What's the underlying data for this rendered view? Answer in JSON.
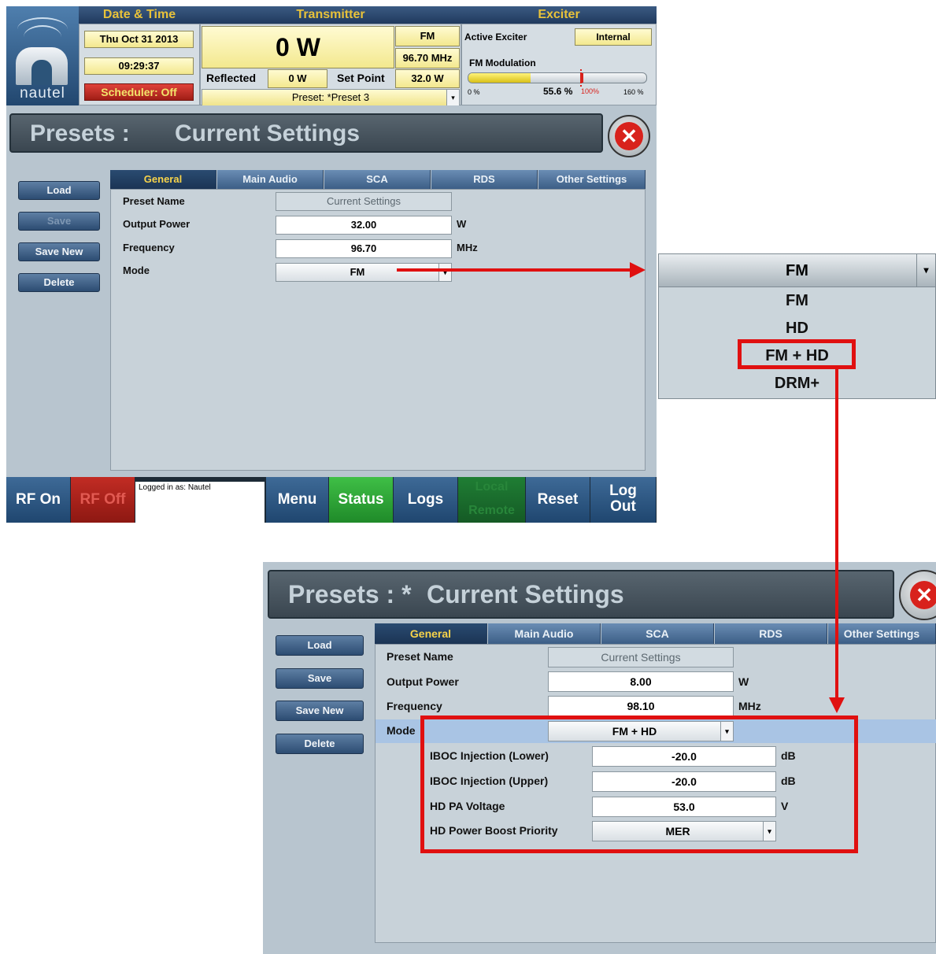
{
  "header": {
    "date_time_label": "Date & Time",
    "transmitter_label": "Transmitter",
    "exciter_label": "Exciter",
    "date": "Thu Oct 31 2013",
    "time": "09:29:37",
    "scheduler": "Scheduler: Off",
    "brand": "nautel",
    "power": "0 W",
    "mode": "FM",
    "frequency": "96.70 MHz",
    "reflected_label": "Reflected",
    "reflected_value": "0 W",
    "set_point_label": "Set Point",
    "set_point_value": "32.0 W",
    "preset": "Preset: *Preset 3",
    "active_exciter_label": "Active Exciter",
    "active_exciter_value": "Internal",
    "fm_modulation_label": "FM Modulation",
    "mod_min": "0 %",
    "mod_value": "55.6 %",
    "mod_100": "100%",
    "mod_max": "160 %",
    "mod_fraction": 0.556
  },
  "screen1": {
    "title_prefix": "Presets :",
    "title_name": "Current Settings",
    "side_buttons": {
      "load": "Load",
      "save": "Save",
      "save_new": "Save New",
      "delete": "Delete"
    },
    "tabs": [
      "General",
      "Main Audio",
      "SCA",
      "RDS",
      "Other Settings"
    ],
    "fields": {
      "preset_name_label": "Preset Name",
      "preset_name_value": "Current Settings",
      "output_power_label": "Output Power",
      "output_power_value": "32.00",
      "output_power_unit": "W",
      "frequency_label": "Frequency",
      "frequency_value": "96.70",
      "frequency_unit": "MHz",
      "mode_label": "Mode",
      "mode_value": "FM"
    }
  },
  "nav": {
    "rf_on": "RF On",
    "rf_off": "RF Off",
    "logged_in": "Logged in as: Nautel",
    "menu": "Menu",
    "status": "Status",
    "logs": "Logs",
    "local": "Local",
    "remote": "Remote",
    "reset": "Reset",
    "log_out_1": "Log",
    "log_out_2": "Out"
  },
  "mode_dropdown": {
    "selected": "FM",
    "options": [
      "FM",
      "HD",
      "FM + HD",
      "DRM+"
    ],
    "highlighted": "FM + HD"
  },
  "screen2": {
    "title_prefix": "Presets : *",
    "title_name": "Current Settings",
    "side_buttons": {
      "load": "Load",
      "save": "Save",
      "save_new": "Save New",
      "delete": "Delete"
    },
    "tabs": [
      "General",
      "Main Audio",
      "SCA",
      "RDS",
      "Other Settings"
    ],
    "fields": {
      "preset_name_label": "Preset Name",
      "preset_name_value": "Current Settings",
      "output_power_label": "Output Power",
      "output_power_value": "8.00",
      "output_power_unit": "W",
      "frequency_label": "Frequency",
      "frequency_value": "98.10",
      "frequency_unit": "MHz",
      "mode_label": "Mode",
      "mode_value": "FM + HD",
      "iboc_lower_label": "IBOC Injection (Lower)",
      "iboc_lower_value": "-20.0",
      "iboc_lower_unit": "dB",
      "iboc_upper_label": "IBOC Injection (Upper)",
      "iboc_upper_value": "-20.0",
      "iboc_upper_unit": "dB",
      "hd_pa_label": "HD PA Voltage",
      "hd_pa_value": "53.0",
      "hd_pa_unit": "V",
      "boost_label": "HD Power Boost Priority",
      "boost_value": "MER"
    }
  },
  "colors": {
    "accent_yellow": "#f7d34a",
    "annotation_red": "#e01010",
    "status_green": "#3fbf46",
    "rf_off_red": "#c22c24"
  }
}
